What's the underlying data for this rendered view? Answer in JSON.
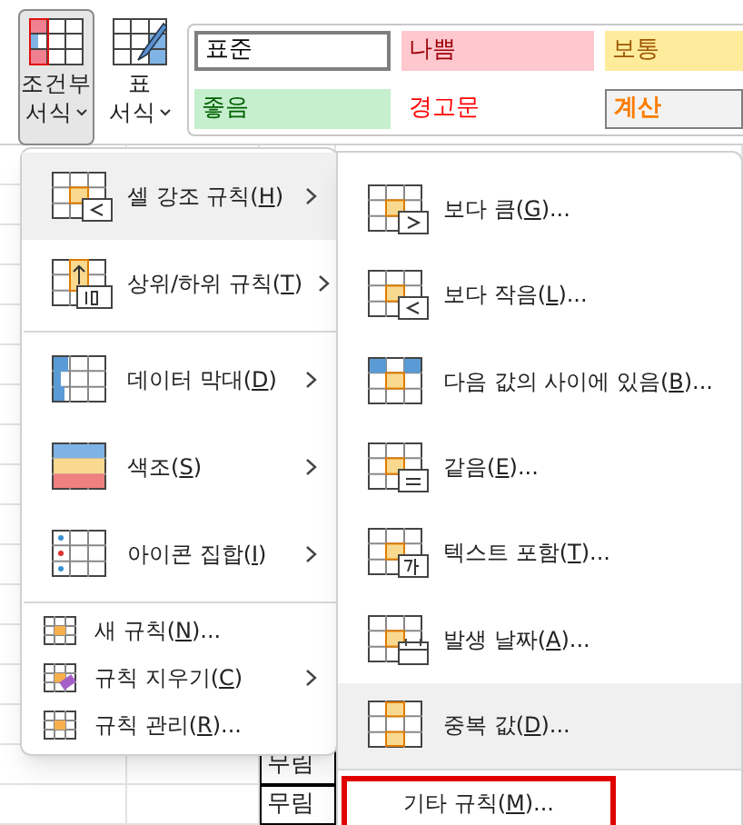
{
  "ribbon": {
    "buttons": [
      {
        "label_lines": [
          "조건부",
          "서식"
        ],
        "selected": true
      },
      {
        "label_lines": [
          "표",
          "서식"
        ],
        "selected": false
      }
    ],
    "styles": [
      {
        "label": "표준",
        "kind": "normal"
      },
      {
        "label": "나쁨",
        "kind": "bad"
      },
      {
        "label": "보통",
        "kind": "neutral"
      },
      {
        "label": "좋음",
        "kind": "good"
      },
      {
        "label": "경고문",
        "kind": "warning"
      },
      {
        "label": "계산",
        "kind": "calculation"
      }
    ]
  },
  "sheet": {
    "cells": [
      "무림",
      "무림"
    ]
  },
  "menu": {
    "items": [
      {
        "kind": "large",
        "label": "셀 강조 규칙(H)",
        "submenu": true,
        "selected": true
      },
      {
        "kind": "large",
        "label": "상위/하위 규칙(T)",
        "submenu": true,
        "selected": false
      },
      {
        "kind": "separator"
      },
      {
        "kind": "large",
        "label": "데이터 막대(D)",
        "submenu": true,
        "selected": false
      },
      {
        "kind": "large",
        "label": "색조(S)",
        "submenu": true,
        "selected": false
      },
      {
        "kind": "large",
        "label": "아이콘 집합(I)",
        "submenu": true,
        "selected": false
      },
      {
        "kind": "separator"
      },
      {
        "kind": "small",
        "label": "새 규칙(N)...",
        "submenu": false,
        "selected": false
      },
      {
        "kind": "small",
        "label": "규칙 지우기(C)",
        "submenu": true,
        "selected": false
      },
      {
        "kind": "small",
        "label": "규칙 관리(R)...",
        "submenu": false,
        "selected": false
      }
    ]
  },
  "submenu": {
    "items": [
      {
        "label": "보다 큼(G)...",
        "selected": false
      },
      {
        "label": "보다 작음(L)...",
        "selected": false
      },
      {
        "label": "다음 값의 사이에 있음(B)...",
        "selected": false
      },
      {
        "label": "같음(E)...",
        "selected": false
      },
      {
        "label": "텍스트 포함(T)...",
        "selected": false
      },
      {
        "label": "발생 날짜(A)...",
        "selected": false
      },
      {
        "label": "중복 값(D)...",
        "selected": true
      }
    ],
    "footer": {
      "label": "기타 규칙(M)...",
      "highlighted": true
    }
  }
}
